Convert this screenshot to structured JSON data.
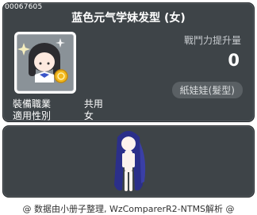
{
  "item": {
    "id": "00067605",
    "name": "蓝色元气学妹发型 (女)",
    "power_label": "戰鬥力提升量",
    "power_value": "0",
    "type_badge": "紙娃娃(髮型)"
  },
  "info": {
    "job_label": "裝備職業",
    "job_value": "共用",
    "gender_label": "適用性別",
    "gender_value": "女"
  },
  "footer": {
    "text": "@ 数据由小册子整理, WzComparerR2-NTMS解析 @"
  },
  "colors": {
    "panel_bg": "#3e4448",
    "hair_blue": "#2b2f8a"
  }
}
